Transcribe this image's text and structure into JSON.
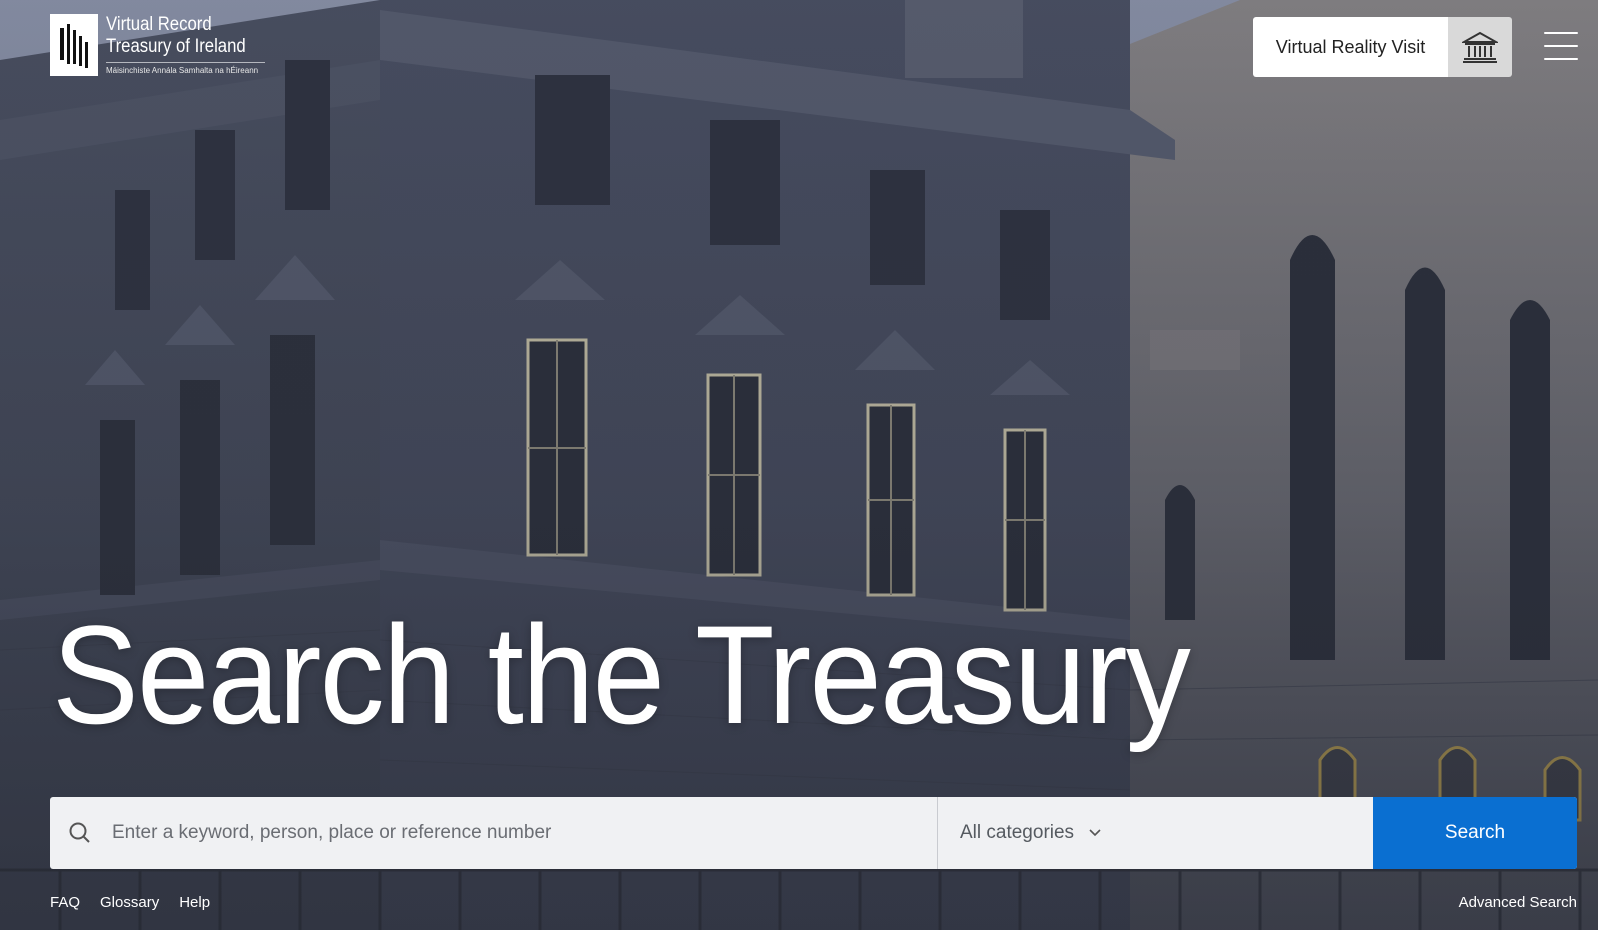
{
  "header": {
    "logo": {
      "line1": "Virtual Record",
      "line2": "Treasury of Ireland",
      "subtitle": "Máisinchiste Annála Samhalta na hÉireann"
    },
    "vr_visit_label": "Virtual Reality Visit",
    "vr_icon": "museum-building-icon",
    "menu_icon": "hamburger-menu-icon"
  },
  "hero": {
    "title": "Search the Treasury"
  },
  "search": {
    "icon": "search-icon",
    "placeholder": "Enter a keyword, person, place or reference number",
    "value": "",
    "category_selected": "All categories",
    "category_icon": "chevron-down-icon",
    "button_label": "Search"
  },
  "footer": {
    "links": [
      "FAQ",
      "Glossary",
      "Help"
    ],
    "advanced_search": "Advanced Search"
  },
  "colors": {
    "accent": "#0a6fd1",
    "search_bar_bg": "#f0f1f3",
    "text_on_image": "#ffffff"
  }
}
